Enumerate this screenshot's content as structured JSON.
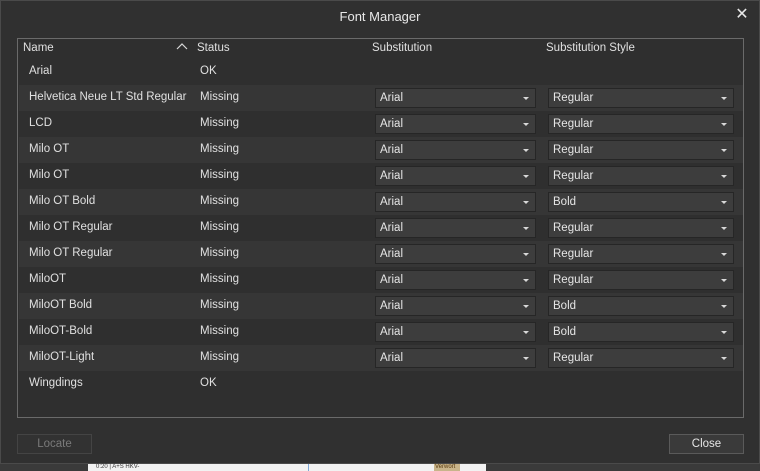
{
  "window": {
    "title": "Font Manager"
  },
  "table": {
    "headers": {
      "name": "Name",
      "status": "Status",
      "substitution": "Substitution",
      "substitution_style": "Substitution Style"
    },
    "rows": [
      {
        "name": "Arial",
        "status": "OK",
        "substitution": "",
        "style": ""
      },
      {
        "name": "Helvetica Neue LT Std Regular",
        "status": "Missing",
        "substitution": "Arial",
        "style": "Regular"
      },
      {
        "name": "LCD",
        "status": "Missing",
        "substitution": "Arial",
        "style": "Regular"
      },
      {
        "name": "Milo OT",
        "status": "Missing",
        "substitution": "Arial",
        "style": "Regular"
      },
      {
        "name": "Milo OT",
        "status": "Missing",
        "substitution": "Arial",
        "style": "Regular"
      },
      {
        "name": "Milo OT Bold",
        "status": "Missing",
        "substitution": "Arial",
        "style": "Bold"
      },
      {
        "name": "Milo OT Regular",
        "status": "Missing",
        "substitution": "Arial",
        "style": "Regular"
      },
      {
        "name": "Milo OT Regular",
        "status": "Missing",
        "substitution": "Arial",
        "style": "Regular"
      },
      {
        "name": "MiloOT",
        "status": "Missing",
        "substitution": "Arial",
        "style": "Regular"
      },
      {
        "name": "MiloOT Bold",
        "status": "Missing",
        "substitution": "Arial",
        "style": "Bold"
      },
      {
        "name": "MiloOT-Bold",
        "status": "Missing",
        "substitution": "Arial",
        "style": "Bold"
      },
      {
        "name": "MiloOT-Light",
        "status": "Missing",
        "substitution": "Arial",
        "style": "Regular"
      },
      {
        "name": "Wingdings",
        "status": "OK",
        "substitution": "",
        "style": ""
      }
    ]
  },
  "buttons": {
    "locate": "Locate",
    "close": "Close"
  },
  "background": {
    "bottom_label": "0:20 | A+S HKV-",
    "bottom_tag": "Verwort"
  },
  "icons": {
    "close": "close-icon",
    "sort": "sort-ascending-icon",
    "dropdown": "chevron-down-icon"
  }
}
